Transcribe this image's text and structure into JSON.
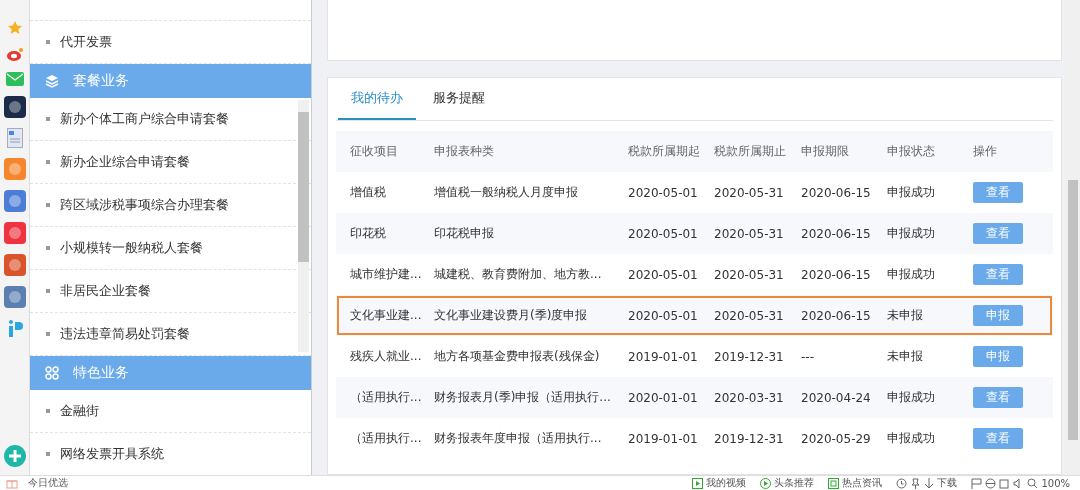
{
  "sidebar": {
    "items": [
      {
        "kind": "item",
        "label": "代开发票"
      },
      {
        "kind": "header",
        "label": "套餐业务"
      },
      {
        "kind": "item",
        "label": "新办个体工商户综合申请套餐"
      },
      {
        "kind": "item",
        "label": "新办企业综合申请套餐"
      },
      {
        "kind": "item",
        "label": "跨区域涉税事项综合办理套餐"
      },
      {
        "kind": "item",
        "label": "小规模转一般纳税人套餐"
      },
      {
        "kind": "item",
        "label": "非居民企业套餐"
      },
      {
        "kind": "item",
        "label": "违法违章简易处罚套餐"
      },
      {
        "kind": "header",
        "label": "特色业务"
      },
      {
        "kind": "item",
        "label": "金融街"
      },
      {
        "kind": "item",
        "label": "网络发票开具系统"
      }
    ]
  },
  "tabs": [
    {
      "label": "我的待办",
      "selected": true
    },
    {
      "label": "服务提醒",
      "selected": false
    }
  ],
  "table": {
    "columns": [
      "征收项目",
      "申报表种类",
      "税款所属期起",
      "税款所属期止",
      "申报期限",
      "申报状态",
      "操作"
    ],
    "rows": [
      {
        "cells": [
          "增值税",
          "增值税一般纳税人月度申报",
          "2020-05-01",
          "2020-05-31",
          "2020-06-15",
          "申报成功"
        ],
        "action": "查看",
        "highlighted": false
      },
      {
        "cells": [
          "印花税",
          "印花税申报",
          "2020-05-01",
          "2020-05-31",
          "2020-06-15",
          "申报成功"
        ],
        "action": "查看",
        "highlighted": false
      },
      {
        "cells": [
          "城市维护建...",
          "城建税、教育费附加、地方教...",
          "2020-05-01",
          "2020-05-31",
          "2020-06-15",
          "申报成功"
        ],
        "action": "查看",
        "highlighted": false
      },
      {
        "cells": [
          "文化事业建...",
          "文化事业建设费月(季)度申报",
          "2020-05-01",
          "2020-05-31",
          "2020-06-15",
          "未申报"
        ],
        "action": "申报",
        "highlighted": true
      },
      {
        "cells": [
          "残疾人就业...",
          "地方各项基金费申报表(残保金)",
          "2019-01-01",
          "2019-12-31",
          "---",
          "未申报"
        ],
        "action": "申报",
        "highlighted": false
      },
      {
        "cells": [
          "（适用执行...",
          "财务报表月(季)申报（适用执行...",
          "2020-01-01",
          "2020-03-31",
          "2020-04-24",
          "申报成功"
        ],
        "action": "查看",
        "highlighted": false
      },
      {
        "cells": [
          "（适用执行...",
          "财务报表年度申报（适用执行...",
          "2019-01-01",
          "2019-12-31",
          "2020-05-29",
          "申报成功"
        ],
        "action": "查看",
        "highlighted": false
      }
    ]
  },
  "status_bar": {
    "left": "今日优选",
    "items": [
      {
        "kind": "video",
        "label": "我的视频"
      },
      {
        "kind": "play",
        "label": "头条推荐"
      },
      {
        "kind": "news",
        "label": "热点资讯"
      },
      {
        "kind": "download",
        "label": "下载"
      },
      {
        "kind": "zoom",
        "label": "100%"
      }
    ]
  }
}
